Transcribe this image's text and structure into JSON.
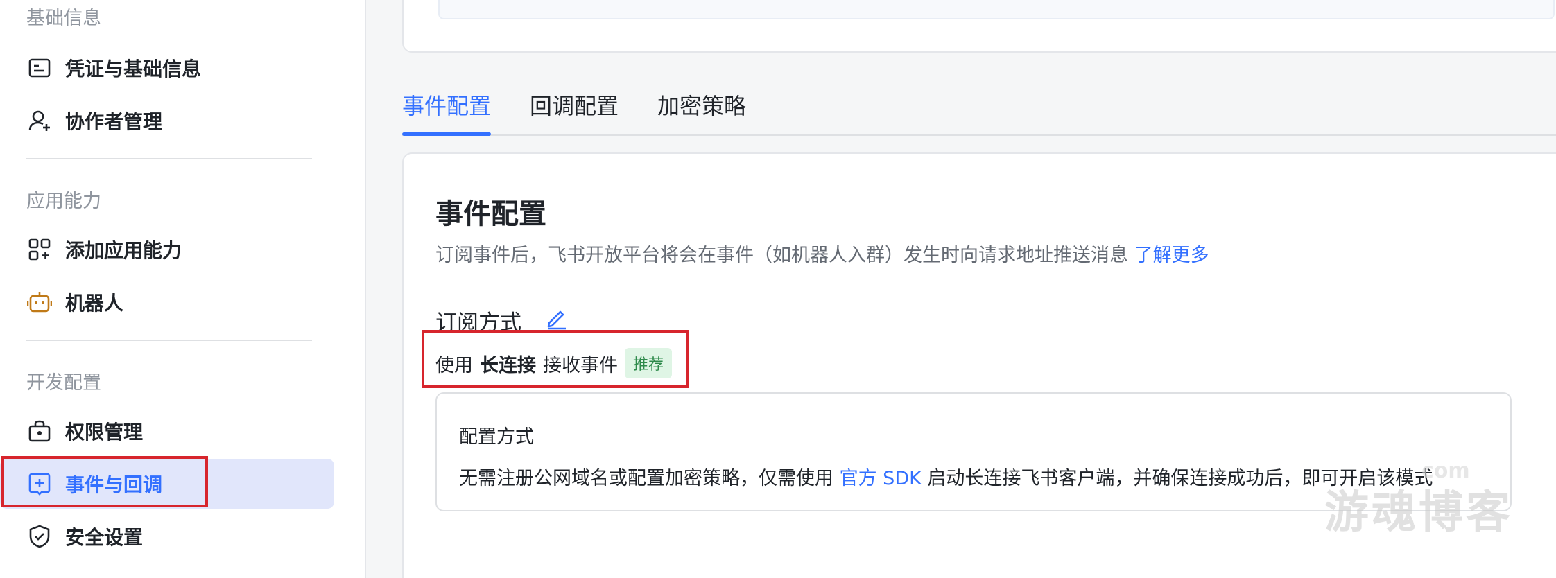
{
  "sidebar": {
    "groups": [
      {
        "title": "基础信息"
      },
      {
        "title": "应用能力"
      },
      {
        "title": "开发配置"
      }
    ],
    "items": [
      {
        "label": "凭证与基础信息",
        "icon": "credential-icon"
      },
      {
        "label": "协作者管理",
        "icon": "user-add-icon"
      },
      {
        "label": "添加应用能力",
        "icon": "app-grid-icon"
      },
      {
        "label": "机器人",
        "icon": "robot-icon"
      },
      {
        "label": "权限管理",
        "icon": "permission-icon"
      },
      {
        "label": "事件与回调",
        "icon": "event-callback-icon"
      },
      {
        "label": "安全设置",
        "icon": "shield-icon"
      }
    ],
    "active_index": 5
  },
  "tabs": [
    {
      "label": "事件配置"
    },
    {
      "label": "回调配置"
    },
    {
      "label": "加密策略"
    }
  ],
  "main": {
    "title": "事件配置",
    "description": "订阅事件后，飞书开放平台将会在事件（如机器人入群）发生时向请求地址推送消息",
    "learn_more": "了解更多",
    "subscription_title": "订阅方式",
    "method_prefix": "使用",
    "method_bold": "长连接",
    "method_suffix": "接收事件",
    "badge": "推荐",
    "config": {
      "title": "配置方式",
      "text_before": "无需注册公网域名或配置加密策略，仅需使用",
      "link": "官方 SDK",
      "text_after": "启动长连接飞书客户端，并确保连接成功后，即可开启该模式"
    }
  },
  "watermark": {
    "main": "游魂博客",
    "small": "com"
  },
  "colors": {
    "accent": "#3370ff",
    "active_bg": "#e1e6fb",
    "highlight_red": "#d7252d",
    "badge_bg": "#dff5e5",
    "badge_text": "#2e8a4b"
  }
}
